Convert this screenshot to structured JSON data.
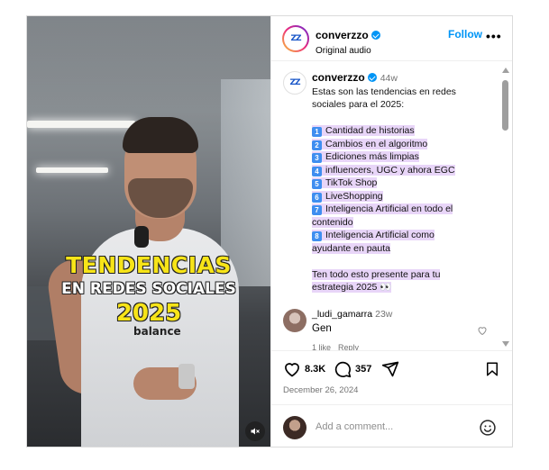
{
  "video": {
    "overlay_line1": "TENDENCIAS",
    "overlay_line2": "EN REDES SOCIALES",
    "overlay_line3": "2025",
    "shirt_brand": "balance"
  },
  "header": {
    "username": "converzzo",
    "subtitle": "Original audio",
    "follow_label": "Follow",
    "more_label": "•••",
    "logo_text": "ZZ"
  },
  "caption": {
    "username": "converzzo",
    "ago": "44w",
    "intro": [
      "Estas son las tendencias en redes",
      "sociales para el 2025:"
    ],
    "items": [
      {
        "num": "1",
        "text": "Cantidad de historias"
      },
      {
        "num": "2",
        "text": "Cambios en el algoritmo"
      },
      {
        "num": "3",
        "text": "Ediciones más limpias"
      },
      {
        "num": "4",
        "text": "influencers, UGC y ahora EGC"
      },
      {
        "num": "5",
        "text": "TikTok Shop"
      },
      {
        "num": "6",
        "text": "LiveShopping"
      },
      {
        "num": "7",
        "text": "Inteligencia Artificial en todo el",
        "cont": "contenido"
      },
      {
        "num": "8",
        "text": "Inteligencia Artificial como",
        "cont": "ayudante en pauta"
      }
    ],
    "outro": [
      "Ten todo esto presente para tu",
      "estrategia 2025 👀"
    ]
  },
  "comment": {
    "username": "_ludi_gamarra",
    "ago": "23w",
    "text": "Gen",
    "likes": "1 like",
    "reply": "Reply"
  },
  "actions": {
    "likes": "8.3K",
    "comments": "357",
    "date": "December 26, 2024"
  },
  "add_comment": {
    "placeholder": "Add a comment..."
  }
}
